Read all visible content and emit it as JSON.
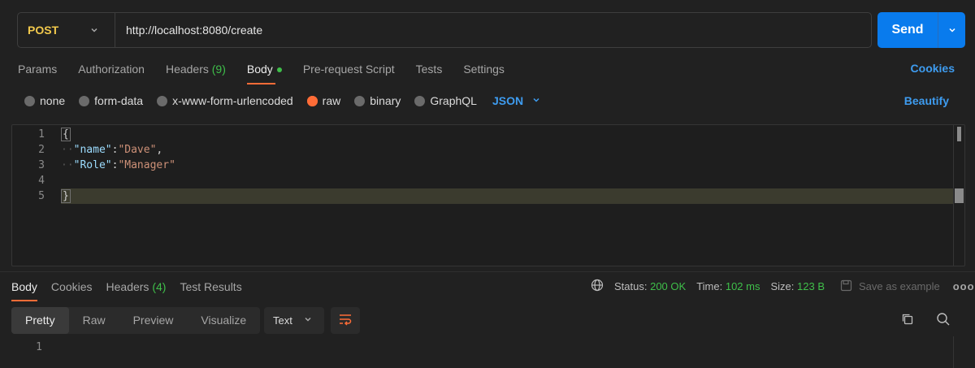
{
  "request": {
    "method": "POST",
    "url": "http://localhost:8080/create",
    "send_label": "Send"
  },
  "request_tabs": [
    {
      "label": "Params"
    },
    {
      "label": "Authorization"
    },
    {
      "label": "Headers",
      "count": "(9)"
    },
    {
      "label": "Body",
      "active": true,
      "indicator": "green-dot"
    },
    {
      "label": "Pre-request Script"
    },
    {
      "label": "Tests"
    },
    {
      "label": "Settings"
    }
  ],
  "cookies_link": "Cookies",
  "body_types": [
    {
      "label": "none"
    },
    {
      "label": "form-data"
    },
    {
      "label": "x-www-form-urlencoded"
    },
    {
      "label": "raw",
      "selected": true
    },
    {
      "label": "binary"
    },
    {
      "label": "GraphQL"
    }
  ],
  "language": "JSON",
  "beautify_label": "Beautify",
  "editor": {
    "line_numbers": [
      "1",
      "2",
      "3",
      "4",
      "5"
    ],
    "line1": "{",
    "line2_key": "\"name\"",
    "line2_colon": ":",
    "line2_value": "\"Dave\"",
    "line2_comma": ",",
    "line3_key": "\"Role\"",
    "line3_colon": ":",
    "line3_value": "\"Manager\"",
    "line5": "}"
  },
  "response_tabs": [
    {
      "label": "Body",
      "active": true
    },
    {
      "label": "Cookies"
    },
    {
      "label": "Headers",
      "count": "(4)"
    },
    {
      "label": "Test Results"
    }
  ],
  "response_status": {
    "status_label": "Status:",
    "status_value": "200 OK",
    "time_label": "Time:",
    "time_value": "102 ms",
    "size_label": "Size:",
    "size_value": "123 B",
    "save_example": "Save as example",
    "more": "ooo"
  },
  "view_modes": [
    {
      "label": "Pretty",
      "active": true
    },
    {
      "label": "Raw"
    },
    {
      "label": "Preview"
    },
    {
      "label": "Visualize"
    }
  ],
  "format": "Text",
  "response_body": {
    "line_numbers": [
      "1"
    ]
  },
  "colors": {
    "accent_orange": "#ff6c37",
    "send_blue": "#097bed",
    "link_blue": "#3e9cf0",
    "success_green": "#3fbf4a",
    "method_yellow": "#f2c94c"
  },
  "icons": [
    "chevron-down-icon",
    "globe-icon",
    "save-icon",
    "wrap-lines-icon",
    "copy-icon",
    "search-icon"
  ]
}
